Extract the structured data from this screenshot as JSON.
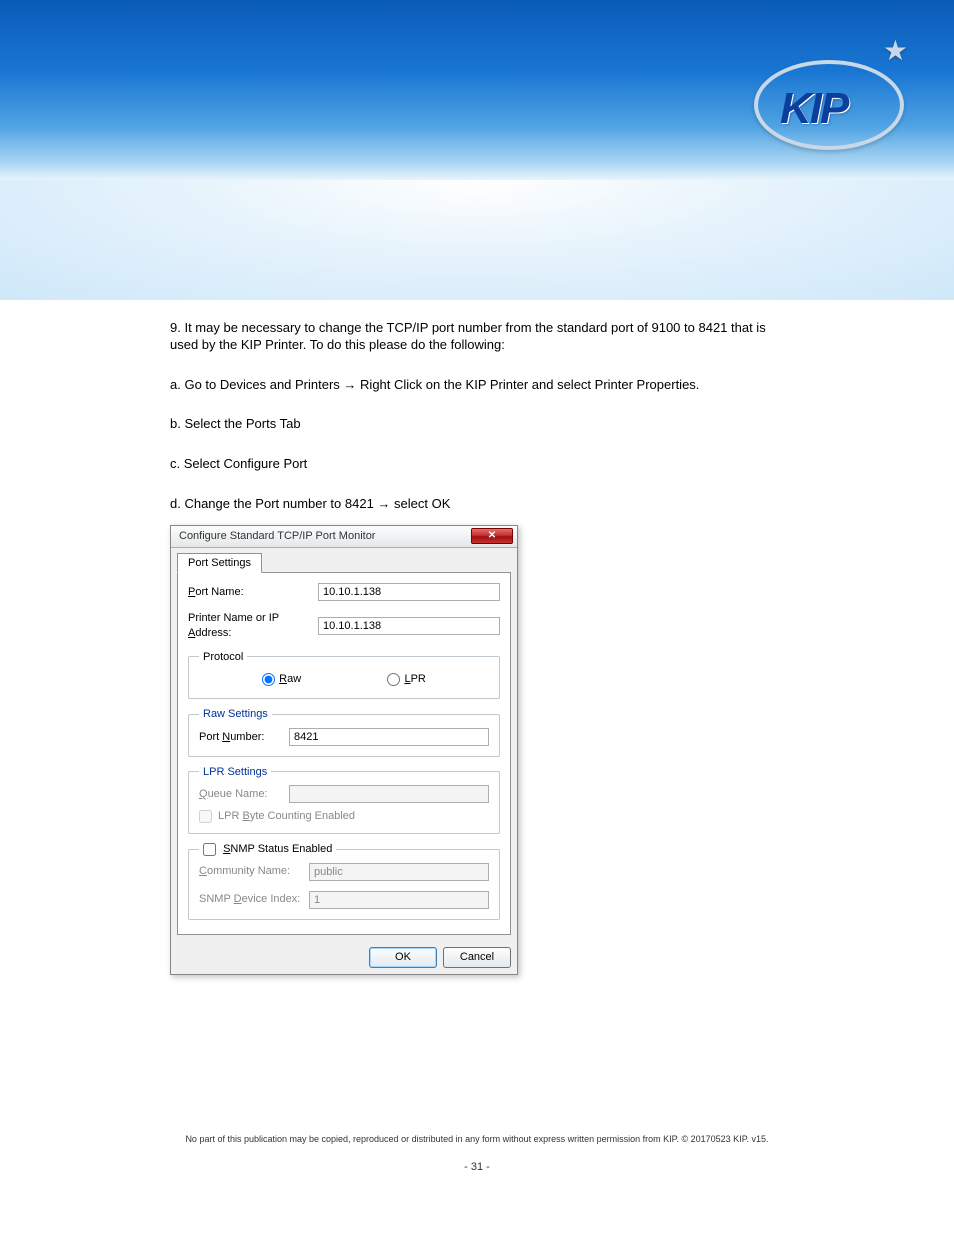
{
  "logo": {
    "text": "KIP"
  },
  "doc": {
    "p1": "9. It may be necessary to change the TCP/IP port number from the standard port of 9100 to 8421 that is used by the KIP Printer. To do this please do the following:",
    "p2_a": "a. Go to Devices and Printers ",
    "p2_b": " Right Click on the KIP Printer and select Printer Properties.",
    "p3": "b. Select the Ports Tab",
    "p4": "c. Select Configure Port",
    "p5_a": "d. Change the Port number to 8421 ",
    "p5_b": " select OK",
    "arrow": "→"
  },
  "dialog": {
    "title": "Configure Standard TCP/IP Port Monitor",
    "tab": "Port Settings",
    "port_name_label": "Port Name:",
    "port_name_value": "10.10.1.138",
    "ip_label": "Printer Name or IP Address:",
    "ip_value": "10.10.1.138",
    "protocol_legend": "Protocol",
    "raw_label": "Raw",
    "lpr_label": "LPR",
    "raw_settings_legend": "Raw Settings",
    "port_number_label": "Port Number:",
    "port_number_value": "8421",
    "lpr_settings_legend": "LPR Settings",
    "queue_label": "Queue Name:",
    "queue_value": "",
    "lpr_byte_label": "LPR Byte Counting Enabled",
    "snmp_enabled_label": "SNMP Status Enabled",
    "community_label": "Community Name:",
    "community_value": "public",
    "snmp_index_label": "SNMP Device Index:",
    "snmp_index_value": "1",
    "ok": "OK",
    "cancel": "Cancel",
    "close_x": "✕"
  },
  "footer": {
    "line1": "No part of this publication may be copied, reproduced or distributed in any form without express written permission from KIP. © 20170523 KIP. v15.",
    "pagenum": "- 31 -"
  }
}
